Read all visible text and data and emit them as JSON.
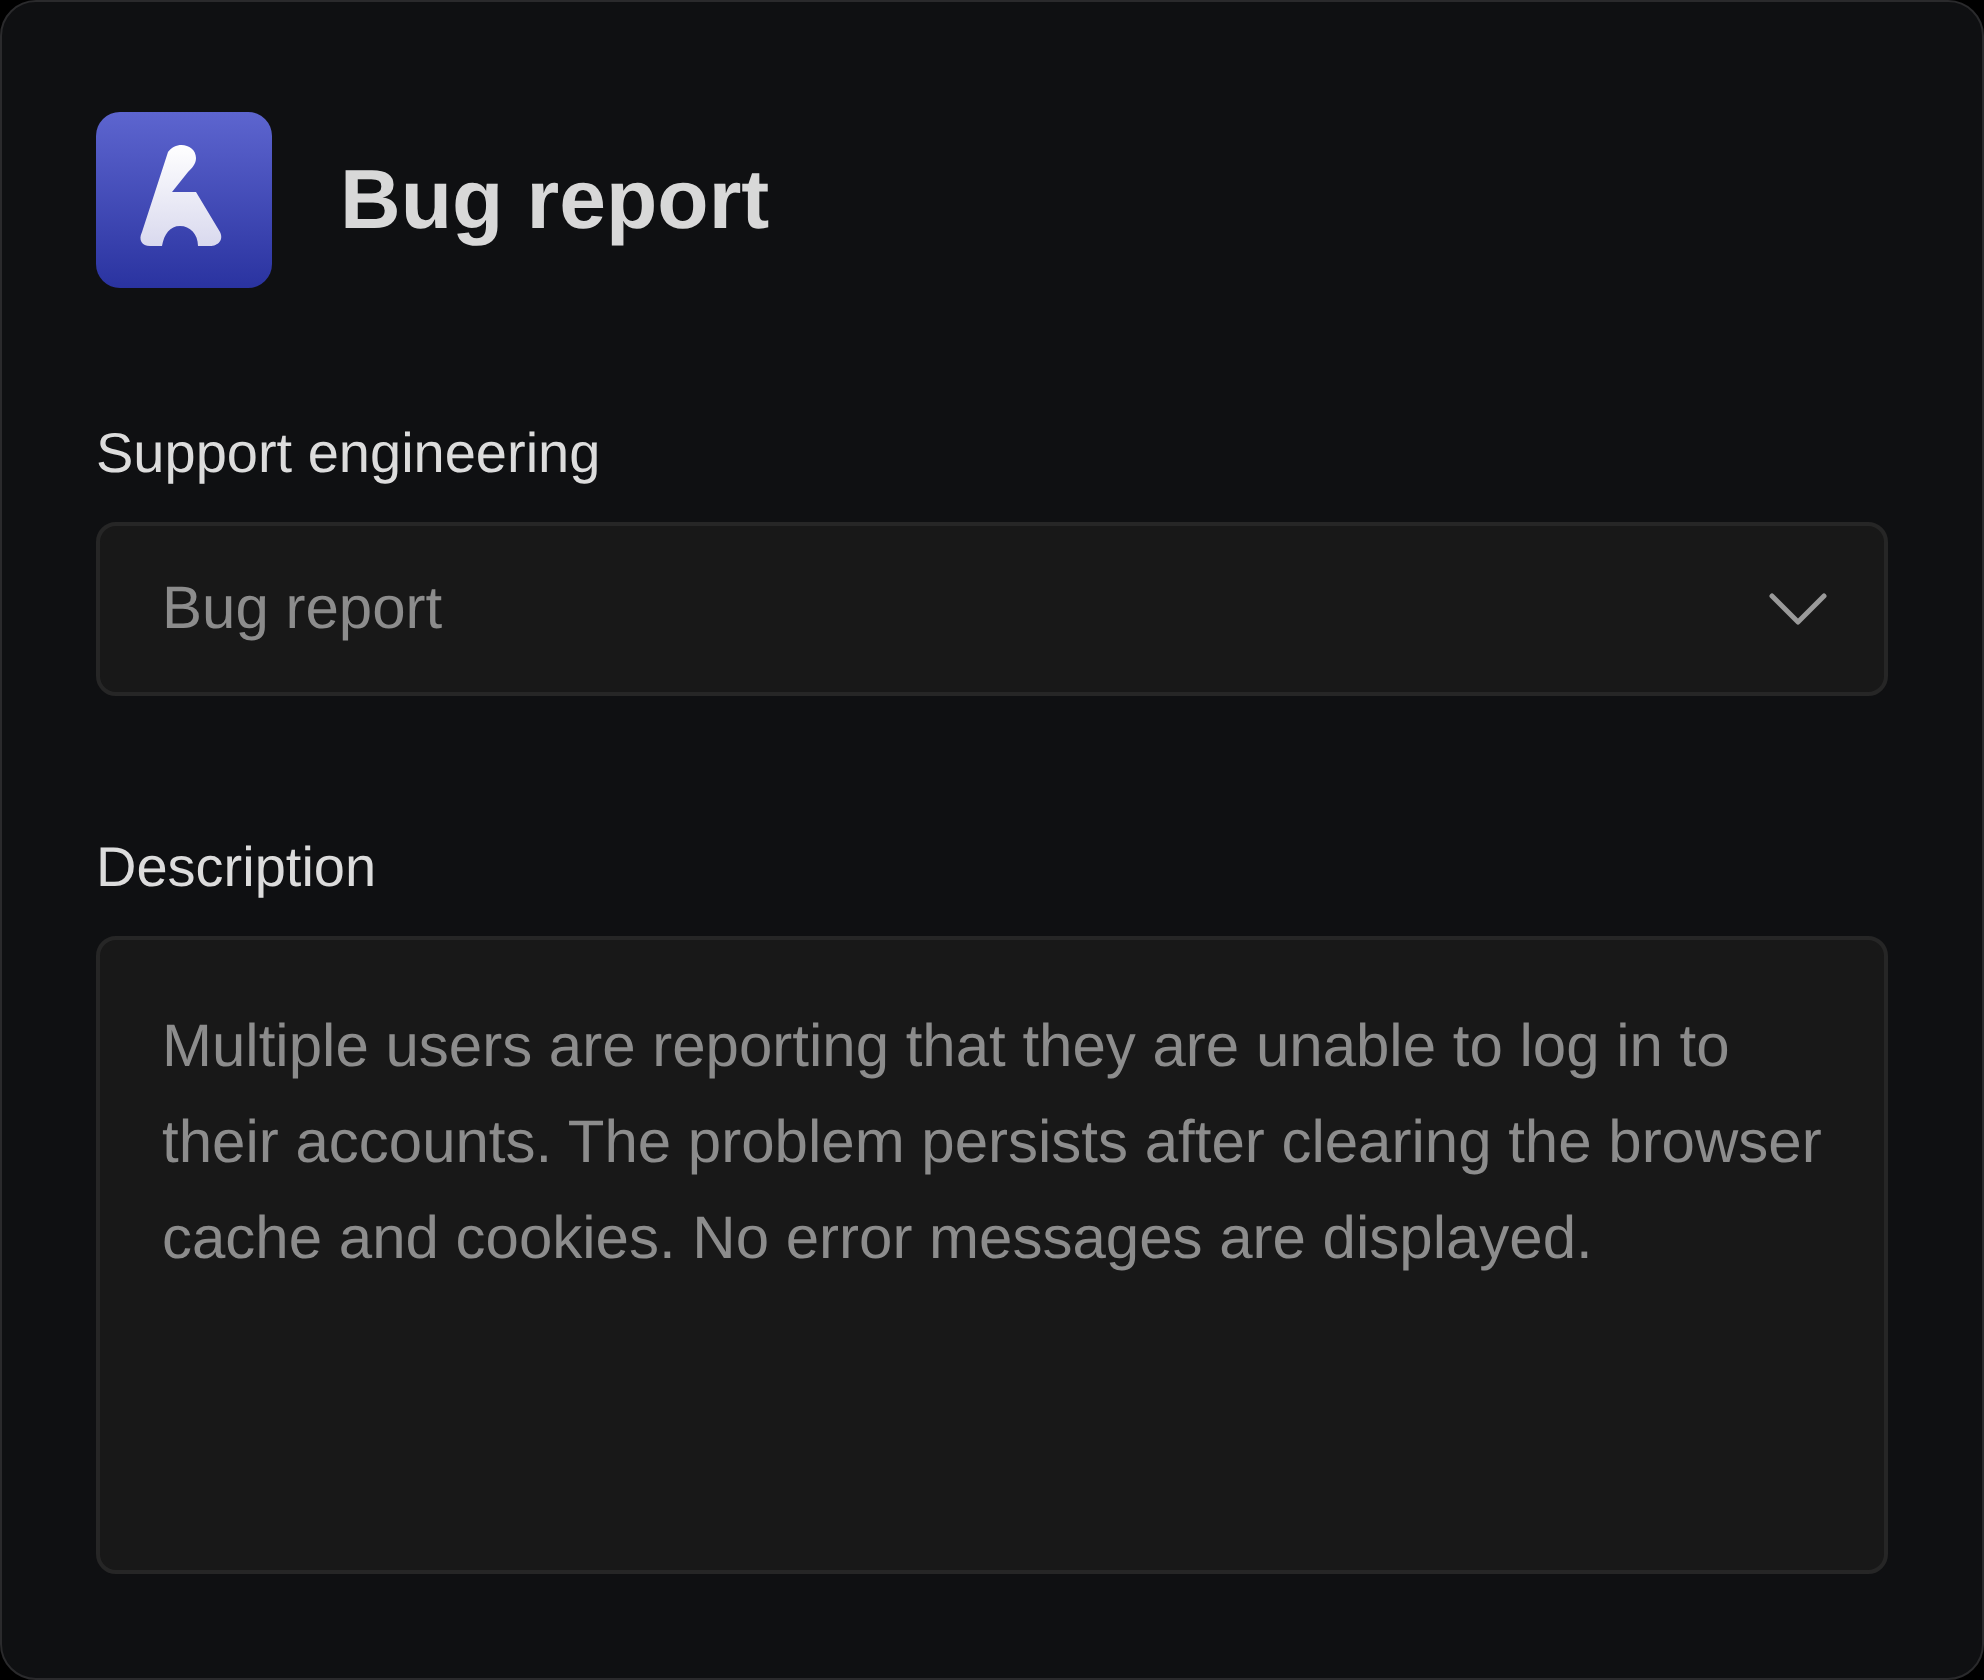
{
  "header": {
    "title": "Bug report"
  },
  "fields": [
    {
      "kind": "select",
      "label": "Support engineering",
      "value": "Bug report"
    },
    {
      "kind": "textarea",
      "label": "Description",
      "value": "Multiple users are reporting that they are unable to log in to their accounts. The problem persists after clearing the browser cache and cookies. No error messages are displayed."
    }
  ]
}
